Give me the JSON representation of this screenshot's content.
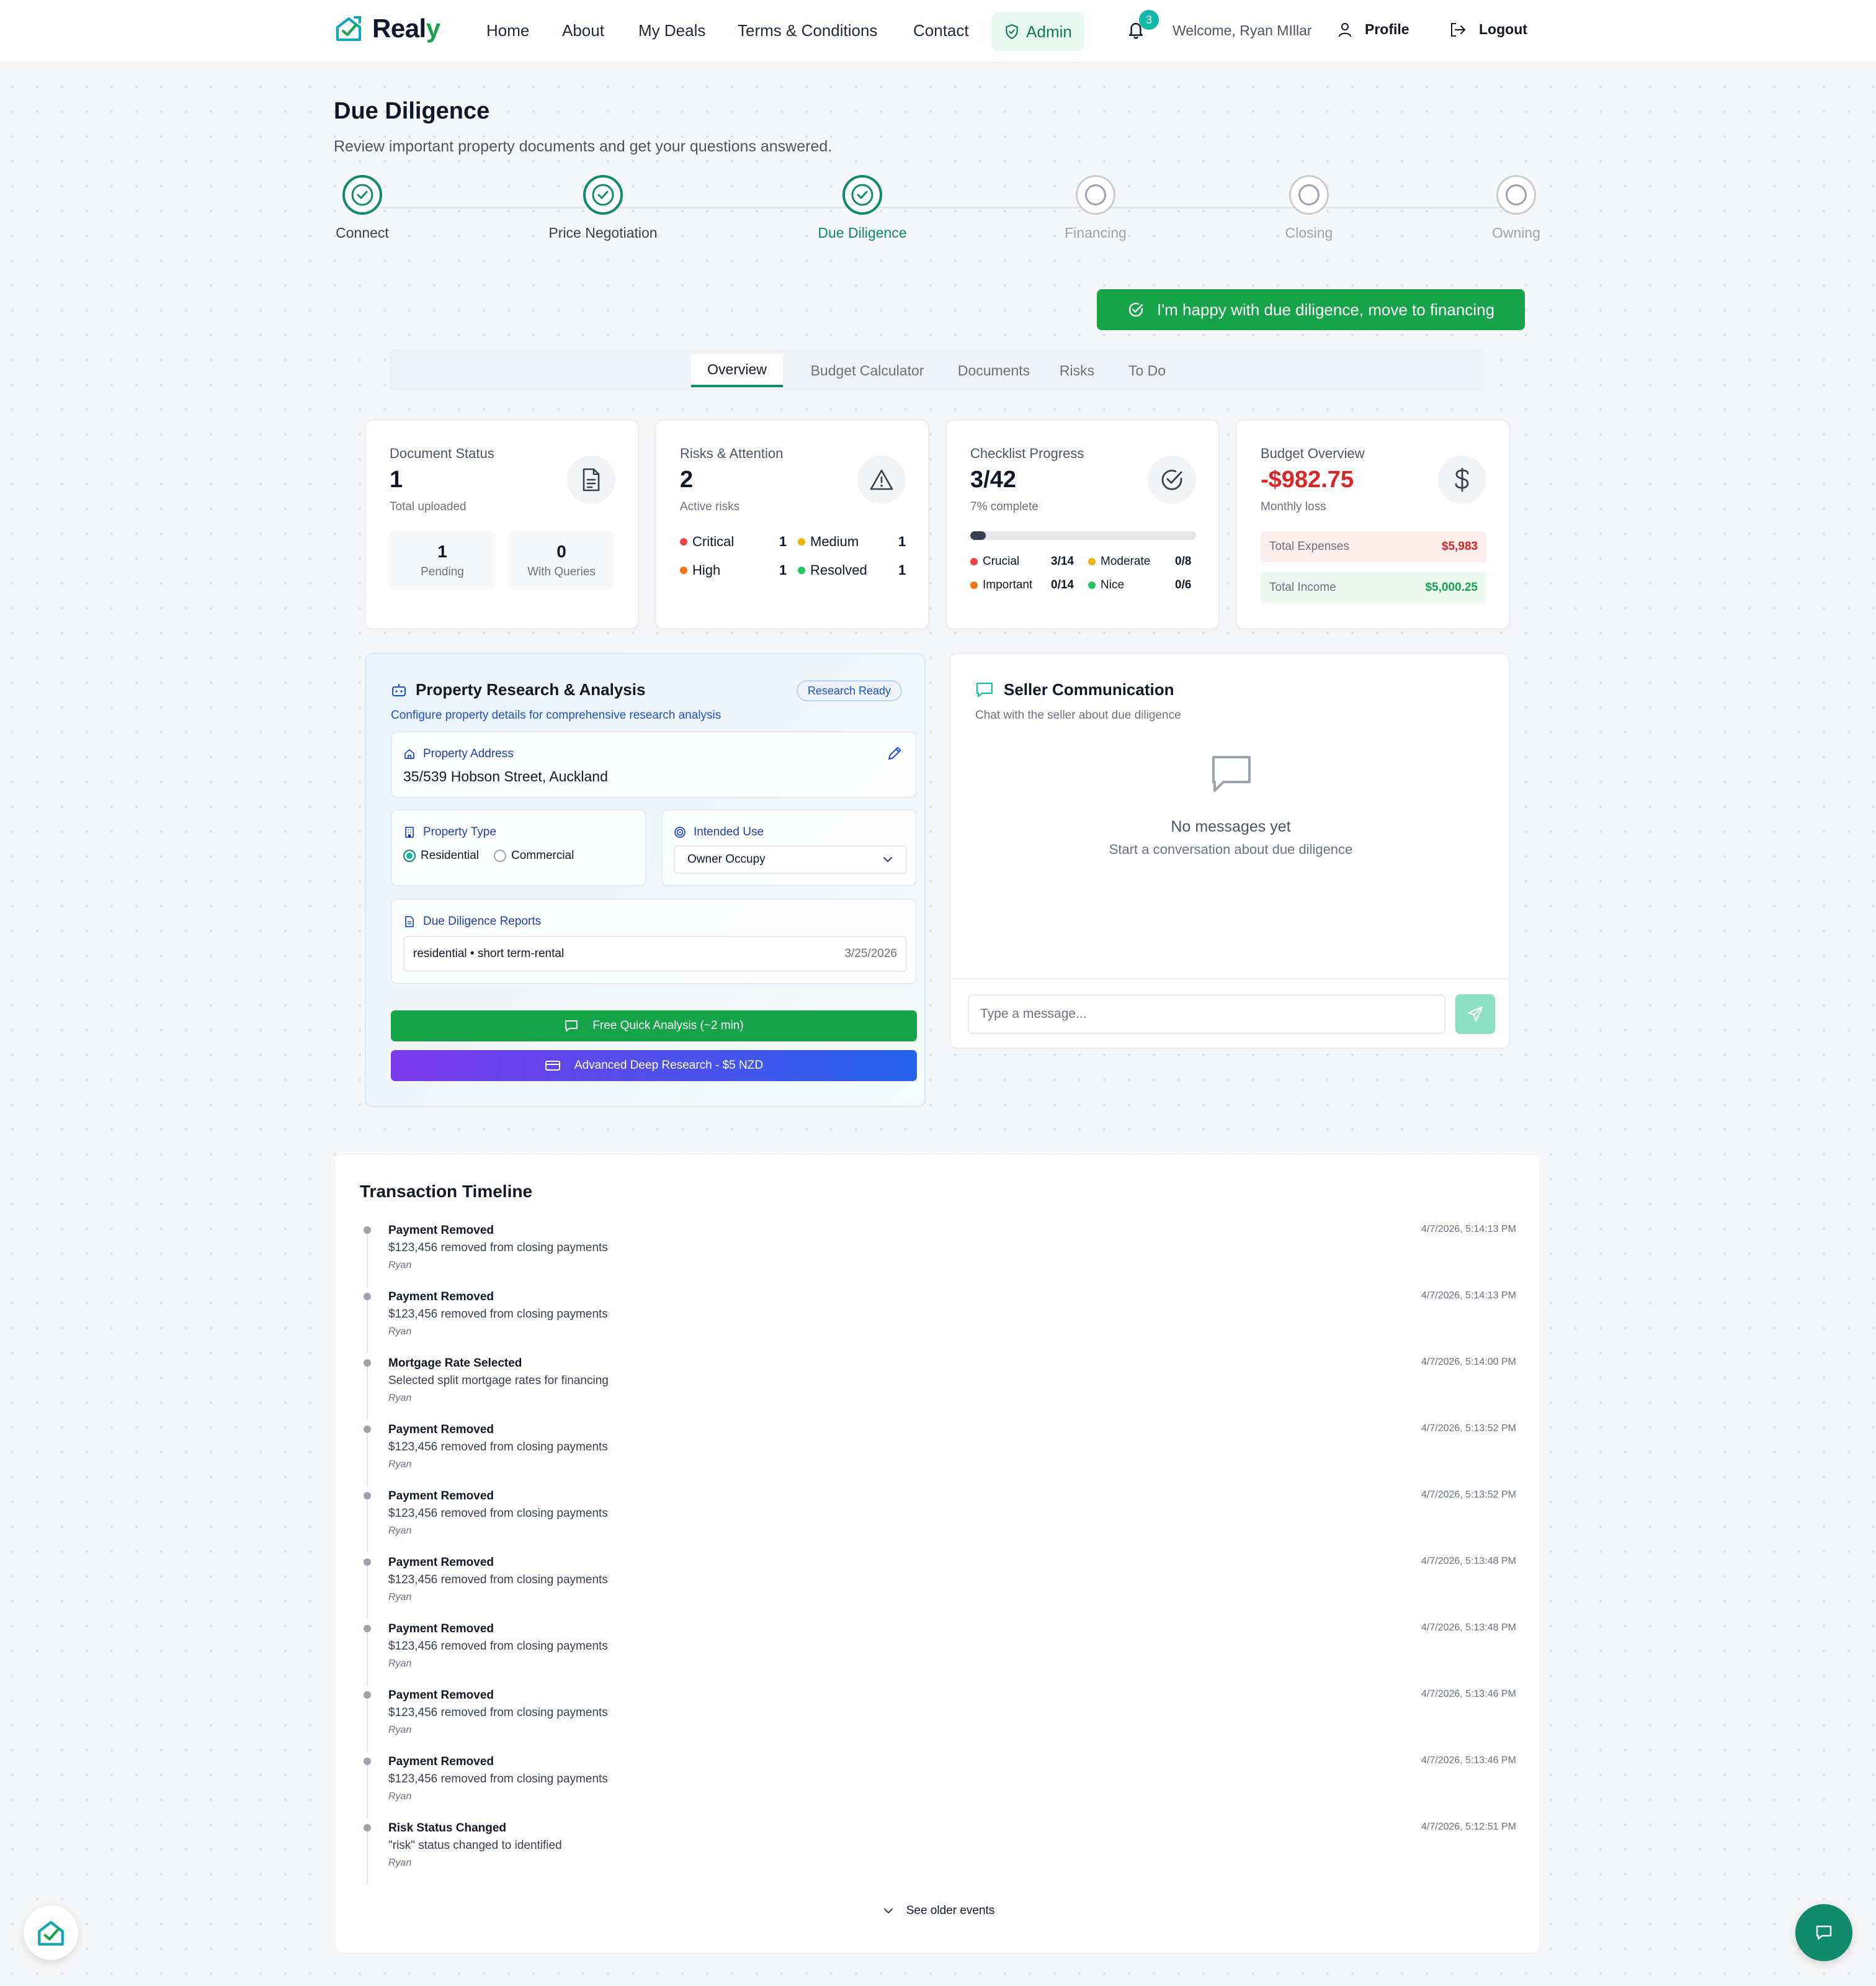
{
  "brand": {
    "name_main": "Real",
    "name_accent": "y"
  },
  "nav": {
    "links": [
      "Home",
      "About",
      "My Deals",
      "Terms & Conditions",
      "Contact"
    ],
    "admin_label": "Admin",
    "notification_count": "3",
    "welcome_text": "Welcome, Ryan MIllar",
    "profile_label": "Profile",
    "logout_label": "Logout"
  },
  "header": {
    "title": "Due Diligence",
    "subtitle": "Review important property documents and get your questions answered."
  },
  "steps": [
    {
      "label": "Connect",
      "state": "done"
    },
    {
      "label": "Price Negotiation",
      "state": "done"
    },
    {
      "label": "Due Diligence",
      "state": "current"
    },
    {
      "label": "Financing",
      "state": "todo"
    },
    {
      "label": "Closing",
      "state": "todo"
    },
    {
      "label": "Owning",
      "state": "todo"
    }
  ],
  "cta": {
    "label": "I'm happy with due diligence, move to financing"
  },
  "tabs": [
    "Overview",
    "Budget Calculator",
    "Documents",
    "Risks",
    "To Do"
  ],
  "stats": {
    "documents": {
      "title": "Document Status",
      "value": "1",
      "caption": "Total uploaded",
      "pending_value": "1",
      "pending_label": "Pending",
      "queries_value": "0",
      "queries_label": "With Queries"
    },
    "risks": {
      "title": "Risks & Attention",
      "value": "2",
      "caption": "Active risks",
      "items": [
        {
          "label": "Critical",
          "count": "1",
          "color": "#ef4444"
        },
        {
          "label": "Medium",
          "count": "1",
          "color": "#eab308"
        },
        {
          "label": "High",
          "count": "1",
          "color": "#f97316"
        },
        {
          "label": "Resolved",
          "count": "1",
          "color": "#22c55e"
        }
      ]
    },
    "checklist": {
      "title": "Checklist Progress",
      "value": "3/42",
      "caption": "7% complete",
      "progress_fraction": 0.07,
      "items": [
        {
          "label": "Crucial",
          "count": "3/14",
          "color": "#ef4444"
        },
        {
          "label": "Moderate",
          "count": "0/8",
          "color": "#eab308"
        },
        {
          "label": "Important",
          "count": "0/14",
          "color": "#f97316"
        },
        {
          "label": "Nice",
          "count": "0/6",
          "color": "#22c55e"
        }
      ]
    },
    "budget": {
      "title": "Budget Overview",
      "value": "-$982.75",
      "caption": "Monthly loss",
      "expenses_label": "Total Expenses",
      "expenses_value": "$5,983",
      "income_label": "Total Income",
      "income_value": "$5,000.25"
    }
  },
  "research": {
    "title": "Property Research & Analysis",
    "badge": "Research Ready",
    "subtitle": "Configure property details for comprehensive research analysis",
    "address_label": "Property Address",
    "address_value": "35/539 Hobson Street, Auckland",
    "type_label": "Property Type",
    "type_options": [
      "Residential",
      "Commercial"
    ],
    "type_selected": "Residential",
    "use_label": "Intended Use",
    "use_selected": "Owner Occupy",
    "reports_label": "Due Diligence Reports",
    "report_name": "residential • short term-rental",
    "report_date": "3/25/2026",
    "quick_button": "Free Quick Analysis (~2 min)",
    "deep_button": "Advanced Deep Research - $5 NZD"
  },
  "seller": {
    "title": "Seller Communication",
    "subtitle": "Chat with the seller about due diligence",
    "empty_title": "No messages yet",
    "empty_subtitle": "Start a conversation about due diligence",
    "input_placeholder": "Type a message..."
  },
  "timeline": {
    "title": "Transaction Timeline",
    "events": [
      {
        "title": "Payment Removed",
        "description": "$123,456 removed from closing payments",
        "user": "Ryan",
        "time": "4/7/2026, 5:14:13 PM"
      },
      {
        "title": "Payment Removed",
        "description": "$123,456 removed from closing payments",
        "user": "Ryan",
        "time": "4/7/2026, 5:14:13 PM"
      },
      {
        "title": "Mortgage Rate Selected",
        "description": "Selected split mortgage rates for financing",
        "user": "Ryan",
        "time": "4/7/2026, 5:14:00 PM"
      },
      {
        "title": "Payment Removed",
        "description": "$123,456 removed from closing payments",
        "user": "Ryan",
        "time": "4/7/2026, 5:13:52 PM"
      },
      {
        "title": "Payment Removed",
        "description": "$123,456 removed from closing payments",
        "user": "Ryan",
        "time": "4/7/2026, 5:13:52 PM"
      },
      {
        "title": "Payment Removed",
        "description": "$123,456 removed from closing payments",
        "user": "Ryan",
        "time": "4/7/2026, 5:13:48 PM"
      },
      {
        "title": "Payment Removed",
        "description": "$123,456 removed from closing payments",
        "user": "Ryan",
        "time": "4/7/2026, 5:13:48 PM"
      },
      {
        "title": "Payment Removed",
        "description": "$123,456 removed from closing payments",
        "user": "Ryan",
        "time": "4/7/2026, 5:13:46 PM"
      },
      {
        "title": "Payment Removed",
        "description": "$123,456 removed from closing payments",
        "user": "Ryan",
        "time": "4/7/2026, 5:13:46 PM"
      },
      {
        "title": "Risk Status Changed",
        "description": "\"risk\" status changed to identified",
        "user": "Ryan",
        "time": "4/7/2026, 5:12:51 PM"
      }
    ],
    "more_label": "See older events"
  },
  "colors": {
    "brand_green": "#16a34a",
    "accent_teal": "#0f8a6a",
    "negative_red": "#dc2626",
    "research_blue": "#1d4ed8"
  }
}
